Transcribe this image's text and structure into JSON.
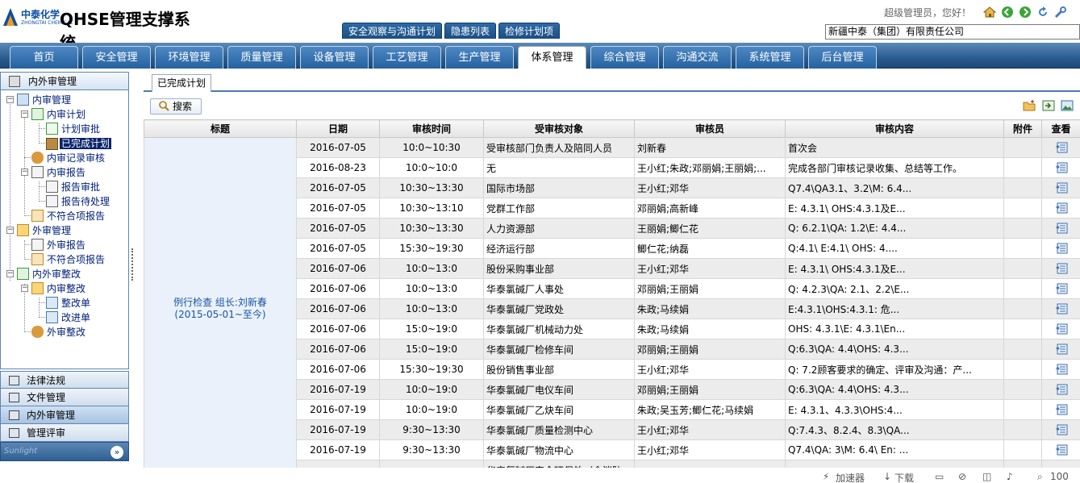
{
  "header": {
    "logo_cn": "中泰化学",
    "logo_en": "ZHONGTAI CHEMICAL",
    "system_title": "QHSE管理支撑系统",
    "sub_tabs": [
      "安全观察与沟通计划",
      "隐患列表",
      "检修计划项"
    ],
    "greeting": "超级管理员，您好！",
    "company": "新疆中泰（集团）有限责任公司",
    "icons": [
      "home-icon",
      "back-icon",
      "forward-icon",
      "refresh-icon",
      "tools-icon"
    ]
  },
  "nav": {
    "tabs": [
      "首页",
      "安全管理",
      "环境管理",
      "质量管理",
      "设备管理",
      "工艺管理",
      "生产管理",
      "体系管理",
      "综合管理",
      "沟通交流",
      "系统管理",
      "后台管理"
    ],
    "active": "体系管理"
  },
  "sidebar": {
    "panel_title": "内外审管理",
    "tree": [
      {
        "label": "内审管理"
      },
      {
        "label": "内审计划"
      },
      {
        "label": "计划审批"
      },
      {
        "label": "已完成计划"
      },
      {
        "label": "内审记录审核"
      },
      {
        "label": "内审报告"
      },
      {
        "label": "报告审批"
      },
      {
        "label": "报告待处理"
      },
      {
        "label": "不符合项报告"
      },
      {
        "label": "外审管理"
      },
      {
        "label": "外审报告"
      },
      {
        "label": "不符合项报告"
      },
      {
        "label": "内外审整改"
      },
      {
        "label": "内审整改"
      },
      {
        "label": "整改单"
      },
      {
        "label": "改进单"
      },
      {
        "label": "外审整改"
      }
    ],
    "accordion": [
      "法律法规",
      "文件管理",
      "内外审管理",
      "管理评审"
    ],
    "footer_logo": "Sunlight"
  },
  "content": {
    "tab": "已完成计划",
    "search_label": "搜索",
    "columns": [
      "标题",
      "日期",
      "审核时间",
      "受审核对象",
      "审核员",
      "审核内容",
      "附件",
      "查看"
    ],
    "group_title_line1": "例行检查 组长:刘新春",
    "group_title_line2": "(2015-05-01~至今)",
    "rows": [
      {
        "date": "2016-07-05",
        "time": "10:0~10:30",
        "target": "受审核部门负责人及陪同人员",
        "auditor": "刘新春",
        "content": "首次会"
      },
      {
        "date": "2016-08-23",
        "time": "10:0~10:0",
        "target": "无",
        "auditor": "王小红;朱政;邓丽娟;王丽娟;...",
        "content": "完成各部门审核记录收集、总结等工作。"
      },
      {
        "date": "2016-07-05",
        "time": "10:30~13:30",
        "target": "国际市场部",
        "auditor": "王小红;邓华",
        "content": "Q7.4\\QA3.1、3.2\\M: 6.4..."
      },
      {
        "date": "2016-07-05",
        "time": "10:30~13:10",
        "target": "党群工作部",
        "auditor": "邓丽娟;高新峰",
        "content": "E: 4.3.1\\ OHS:4.3.1及E..."
      },
      {
        "date": "2016-07-05",
        "time": "10:30~13:30",
        "target": "人力资源部",
        "auditor": "王丽娟;鲫仁花",
        "content": "Q: 6.2.1\\QA: 1.2\\E: 4.4..."
      },
      {
        "date": "2016-07-05",
        "time": "15:30~19:30",
        "target": "经济运行部",
        "auditor": "鲫仁花;纳磊",
        "content": "Q:4.1\\ E:4.1\\ OHS: 4...."
      },
      {
        "date": "2016-07-06",
        "time": "10:0~13:0",
        "target": "股份采购事业部",
        "auditor": "王小红;邓华",
        "content": "E: 4.3.1\\ OHS:4.3.1及E..."
      },
      {
        "date": "2016-07-06",
        "time": "10:0~13:0",
        "target": "华泰氯碱厂人事处",
        "auditor": "邓丽娟;王丽娟",
        "content": "Q: 4.2.3\\QA: 2.1、2.2\\E..."
      },
      {
        "date": "2016-07-06",
        "time": "10:0~13:0",
        "target": "华泰氯碱厂党政处",
        "auditor": "朱政;马续娟",
        "content": "E:4.3.1\\OHS:4.3.1: 危..."
      },
      {
        "date": "2016-07-06",
        "time": "15:0~19:0",
        "target": "华泰氯碱厂机械动力处",
        "auditor": "朱政;马续娟",
        "content": "OHS: 4.3.1\\E: 4.3.1\\En..."
      },
      {
        "date": "2016-07-06",
        "time": "15:0~19:0",
        "target": "华泰氯碱厂检修车间",
        "auditor": "邓丽娟;王丽娟",
        "content": "Q:6.3\\QA: 4.4\\OHS: 4.3..."
      },
      {
        "date": "2016-07-06",
        "time": "15:30~19:30",
        "target": "股份销售事业部",
        "auditor": "王小红;邓华",
        "content": "Q: 7.2顾客要求的确定、评审及沟通：产..."
      },
      {
        "date": "2016-07-19",
        "time": "10:0~19:0",
        "target": "华泰氯碱厂电仪车间",
        "auditor": "邓丽娟;王丽娟",
        "content": "Q:6.3\\QA: 4.4\\OHS: 4.3..."
      },
      {
        "date": "2016-07-19",
        "time": "10:0~19:0",
        "target": "华泰氯碱厂乙炔车间",
        "auditor": "朱政;吴玉芳;鲫仁花;马续娟",
        "content": "E: 4.3.1、4.3.3\\OHS:4..."
      },
      {
        "date": "2016-07-19",
        "time": "9:30~13:30",
        "target": "华泰氯碱厂质量检测中心",
        "auditor": "王小红;邓华",
        "content": "Q:7.4.3、8.2.4、8.3\\QA..."
      },
      {
        "date": "2016-07-19",
        "time": "9:30~13:30",
        "target": "华泰氯碱厂物流中心",
        "auditor": "王小红;邓华",
        "content": "Q7.4\\QA: 3\\M: 6.4\\ En: ..."
      },
      {
        "date": "",
        "time": "",
        "target": "华泰氯碱厂安全环保处（含消防...",
        "auditor": "",
        "content": ""
      }
    ]
  },
  "statusbar": {
    "accelerator": "加速器",
    "download": "下载",
    "zoom": "100"
  }
}
